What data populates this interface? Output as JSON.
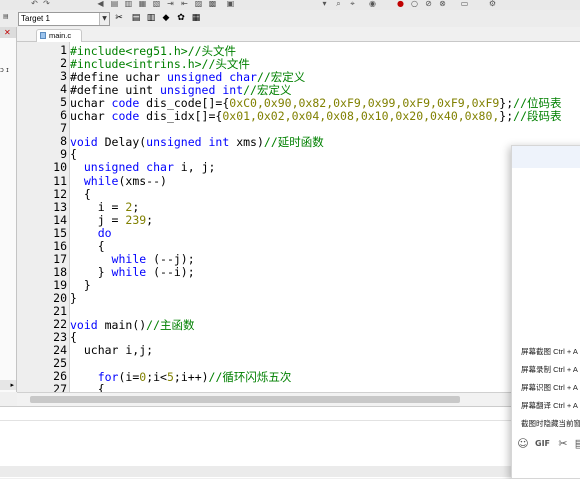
{
  "toolbar": {
    "target": "Target 1"
  },
  "tab": {
    "label": "main.c"
  },
  "line_numbers": [
    "1",
    "2",
    "3",
    "4",
    "5",
    "6",
    "7",
    "8",
    "9",
    "10",
    "11",
    "12",
    "13",
    "14",
    "15",
    "16",
    "17",
    "18",
    "19",
    "20",
    "21",
    "22",
    "23",
    "24",
    "25",
    "26",
    "27"
  ],
  "code_lines": [
    [
      {
        "t": "#include<reg51.h>//头文件",
        "c": "cm"
      }
    ],
    [
      {
        "t": "#include<intrins.h>//头文件",
        "c": "cm"
      }
    ],
    [
      {
        "t": "#define uchar ",
        "c": ""
      },
      {
        "t": "unsigned char",
        "c": "kw"
      },
      {
        "t": "//宏定义",
        "c": "cm"
      }
    ],
    [
      {
        "t": "#define uint ",
        "c": ""
      },
      {
        "t": "unsigned int",
        "c": "kw"
      },
      {
        "t": "//宏定义",
        "c": "cm"
      }
    ],
    [
      {
        "t": "uchar ",
        "c": ""
      },
      {
        "t": "code",
        "c": "kw"
      },
      {
        "t": " dis_code[]={",
        "c": ""
      },
      {
        "t": "0xC0,0x90,0x82,0xF9,0x99,0xF9,0xF9,0xF9",
        "c": "nm"
      },
      {
        "t": "};",
        "c": ""
      },
      {
        "t": "//位码表",
        "c": "cm"
      }
    ],
    [
      {
        "t": "uchar ",
        "c": ""
      },
      {
        "t": "code",
        "c": "kw"
      },
      {
        "t": " dis_idx[]={",
        "c": ""
      },
      {
        "t": "0x01,0x02,0x04,0x08,0x10,0x20,0x40,0x80,",
        "c": "nm"
      },
      {
        "t": "};",
        "c": ""
      },
      {
        "t": "//段码表",
        "c": "cm"
      }
    ],
    [
      {
        "t": "",
        "c": ""
      }
    ],
    [
      {
        "t": "void",
        "c": "kw"
      },
      {
        "t": " Delay(",
        "c": ""
      },
      {
        "t": "unsigned int",
        "c": "kw"
      },
      {
        "t": " xms)",
        "c": ""
      },
      {
        "t": "//延时函数",
        "c": "cm"
      }
    ],
    [
      {
        "t": "{",
        "c": ""
      }
    ],
    [
      {
        "t": "  ",
        "c": ""
      },
      {
        "t": "unsigned char",
        "c": "kw"
      },
      {
        "t": " i, j;",
        "c": ""
      }
    ],
    [
      {
        "t": "  ",
        "c": ""
      },
      {
        "t": "while",
        "c": "kw"
      },
      {
        "t": "(xms--)",
        "c": ""
      }
    ],
    [
      {
        "t": "  {",
        "c": ""
      }
    ],
    [
      {
        "t": "    i = ",
        "c": ""
      },
      {
        "t": "2",
        "c": "nm"
      },
      {
        "t": ";",
        "c": ""
      }
    ],
    [
      {
        "t": "    j = ",
        "c": ""
      },
      {
        "t": "239",
        "c": "nm"
      },
      {
        "t": ";",
        "c": ""
      }
    ],
    [
      {
        "t": "    ",
        "c": ""
      },
      {
        "t": "do",
        "c": "kw"
      }
    ],
    [
      {
        "t": "    {",
        "c": ""
      }
    ],
    [
      {
        "t": "      ",
        "c": ""
      },
      {
        "t": "while",
        "c": "kw"
      },
      {
        "t": " (--j);",
        "c": ""
      }
    ],
    [
      {
        "t": "    } ",
        "c": ""
      },
      {
        "t": "while",
        "c": "kw"
      },
      {
        "t": " (--i);",
        "c": ""
      }
    ],
    [
      {
        "t": "  }",
        "c": ""
      }
    ],
    [
      {
        "t": "}",
        "c": ""
      }
    ],
    [
      {
        "t": "",
        "c": ""
      }
    ],
    [
      {
        "t": "void",
        "c": "kw"
      },
      {
        "t": " main()",
        "c": ""
      },
      {
        "t": "//主函数",
        "c": "cm"
      }
    ],
    [
      {
        "t": "{",
        "c": ""
      }
    ],
    [
      {
        "t": "  uchar i,j;",
        "c": ""
      }
    ],
    [
      {
        "t": "",
        "c": ""
      }
    ],
    [
      {
        "t": "    ",
        "c": ""
      },
      {
        "t": "for",
        "c": "kw"
      },
      {
        "t": "(i=",
        "c": ""
      },
      {
        "t": "0",
        "c": "nm"
      },
      {
        "t": ";i<",
        "c": ""
      },
      {
        "t": "5",
        "c": "nm"
      },
      {
        "t": ";i++)",
        "c": ""
      },
      {
        "t": "//循环闪烁五次",
        "c": "cm"
      }
    ],
    [
      {
        "t": "    {",
        "c": ""
      }
    ]
  ],
  "popup_menu": {
    "items": [
      "屏幕截图 Ctrl + A",
      "屏幕录制 Ctrl + A",
      "屏幕识图 Ctrl + A",
      "屏幕翻译 Ctrl + A",
      "截图时隐藏当前窗"
    ]
  },
  "colors": {
    "keyword": "#0000ff",
    "comment": "#008000",
    "number": "#808000"
  }
}
